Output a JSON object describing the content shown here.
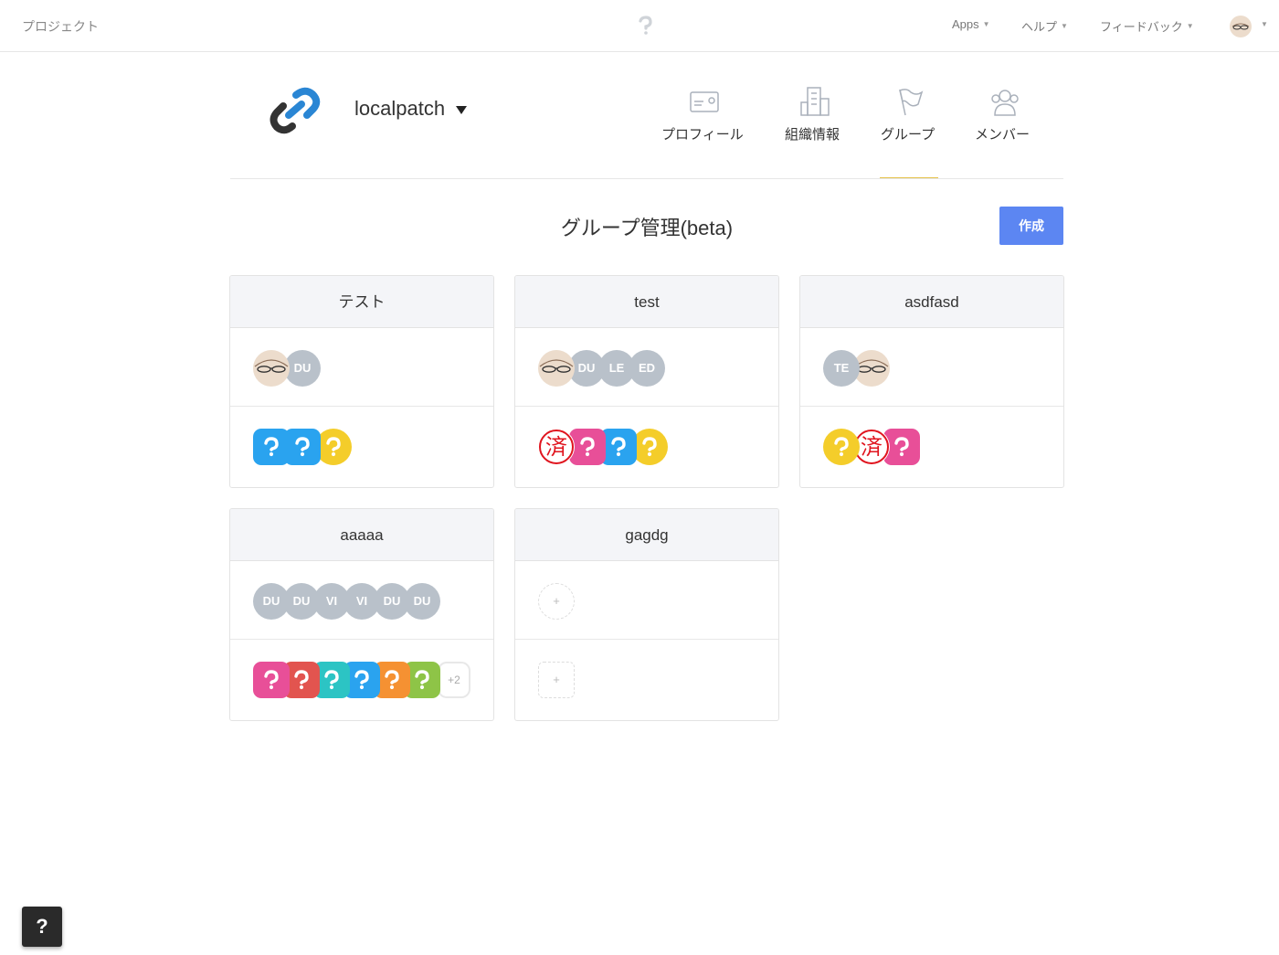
{
  "topbar": {
    "project_label": "プロジェクト",
    "apps": "Apps",
    "help": "ヘルプ",
    "feedback": "フィードバック"
  },
  "org": {
    "name": "localpatch"
  },
  "nav": {
    "profile": "プロフィール",
    "org_info": "組織情報",
    "group": "グループ",
    "member": "メンバー"
  },
  "page": {
    "title": "グループ管理(beta)",
    "create_label": "作成"
  },
  "colors": {
    "accent": "#5c86f2",
    "tab_underline": "#e6c24a",
    "avatar_gray": "#b9c1ca",
    "project_blue": "#2aa3ef",
    "project_yellow": "#f4cd2a",
    "project_pink": "#e84f98",
    "project_red": "#e2544f",
    "project_teal": "#2cc4c4",
    "project_orange": "#f59132",
    "project_green": "#8ec447",
    "stamp_red": "#e0141e"
  },
  "groups": [
    {
      "name": "テスト",
      "members": [
        {
          "type": "photo"
        },
        {
          "type": "initials",
          "text": "DU"
        }
      ],
      "projects": [
        {
          "icon": "p-icon",
          "color": "blue"
        },
        {
          "icon": "p-icon",
          "color": "blue"
        },
        {
          "icon": "p-icon",
          "color": "yellow"
        }
      ]
    },
    {
      "name": "test",
      "members": [
        {
          "type": "photo"
        },
        {
          "type": "initials",
          "text": "DU"
        },
        {
          "type": "initials",
          "text": "LE"
        },
        {
          "type": "initials",
          "text": "ED"
        }
      ],
      "projects": [
        {
          "icon": "sumi-stamp",
          "text": "済"
        },
        {
          "icon": "p-icon",
          "color": "pink"
        },
        {
          "icon": "p-icon",
          "color": "blue"
        },
        {
          "icon": "p-icon",
          "color": "yellow"
        }
      ]
    },
    {
      "name": "asdfasd",
      "members": [
        {
          "type": "initials",
          "text": "TE"
        },
        {
          "type": "photo"
        }
      ],
      "projects": [
        {
          "icon": "p-icon",
          "color": "yellow"
        },
        {
          "icon": "sumi-stamp",
          "text": "済"
        },
        {
          "icon": "p-icon",
          "color": "pink"
        }
      ]
    },
    {
      "name": "aaaaa",
      "members": [
        {
          "type": "initials",
          "text": "DU"
        },
        {
          "type": "initials",
          "text": "DU"
        },
        {
          "type": "initials",
          "text": "VI"
        },
        {
          "type": "initials",
          "text": "VI"
        },
        {
          "type": "initials",
          "text": "DU"
        },
        {
          "type": "initials",
          "text": "DU"
        }
      ],
      "projects": [
        {
          "icon": "p-icon",
          "color": "pink"
        },
        {
          "icon": "p-icon",
          "color": "red"
        },
        {
          "icon": "p-icon",
          "color": "teal"
        },
        {
          "icon": "p-icon",
          "color": "blue"
        },
        {
          "icon": "p-icon",
          "color": "orange"
        },
        {
          "icon": "p-icon",
          "color": "green"
        }
      ],
      "more_projects": "+2"
    },
    {
      "name": "gagdg",
      "members": [],
      "projects": [],
      "add_member": "+",
      "add_project": "+"
    }
  ],
  "help_button": "?"
}
